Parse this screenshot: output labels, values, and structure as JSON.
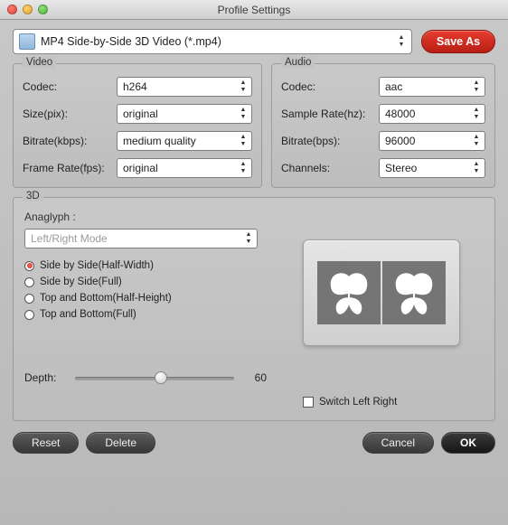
{
  "window": {
    "title": "Profile Settings"
  },
  "profile": {
    "selected": "MP4 Side-by-Side 3D Video (*.mp4)",
    "save_as": "Save As"
  },
  "video": {
    "title": "Video",
    "codec_label": "Codec:",
    "codec": "h264",
    "size_label": "Size(pix):",
    "size": "original",
    "bitrate_label": "Bitrate(kbps):",
    "bitrate": "medium quality",
    "framerate_label": "Frame Rate(fps):",
    "framerate": "original"
  },
  "audio": {
    "title": "Audio",
    "codec_label": "Codec:",
    "codec": "aac",
    "samplerate_label": "Sample Rate(hz):",
    "samplerate": "48000",
    "bitrate_label": "Bitrate(bps):",
    "bitrate": "96000",
    "channels_label": "Channels:",
    "channels": "Stereo"
  },
  "three_d": {
    "title": "3D",
    "anaglyph_label": "Anaglyph :",
    "anaglyph_mode": "Left/Right Mode",
    "options": [
      {
        "label": "Side by Side(Half-Width)",
        "selected": true
      },
      {
        "label": "Side by Side(Full)",
        "selected": false
      },
      {
        "label": "Top and Bottom(Half-Height)",
        "selected": false
      },
      {
        "label": "Top and Bottom(Full)",
        "selected": false
      }
    ],
    "depth_label": "Depth:",
    "depth_value": "60",
    "switch_label": "Switch Left Right"
  },
  "buttons": {
    "reset": "Reset",
    "delete": "Delete",
    "cancel": "Cancel",
    "ok": "OK"
  }
}
